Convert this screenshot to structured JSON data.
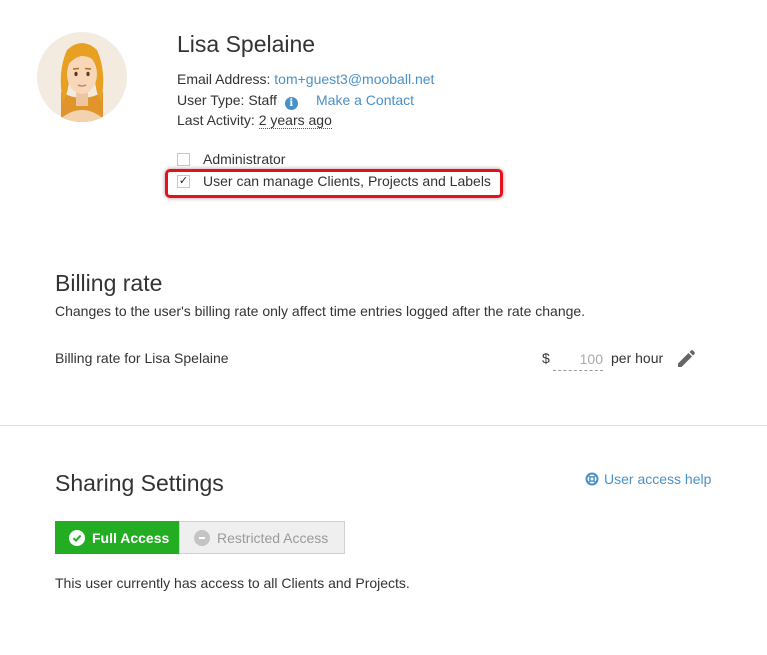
{
  "profile": {
    "name": "Lisa Spelaine",
    "email_label": "Email Address:",
    "email": "tom+guest3@mooball.net",
    "user_type_label": "User Type:",
    "user_type": "Staff",
    "info_icon_glyph": "i",
    "make_contact": "Make a Contact",
    "last_activity_label": "Last Activity:",
    "last_activity": "2 years ago"
  },
  "permissions": {
    "administrator": {
      "label": "Administrator",
      "checked": false
    },
    "manage": {
      "label": "User can manage Clients, Projects and Labels",
      "checked": true,
      "check_glyph": "✓"
    }
  },
  "billing": {
    "title": "Billing rate",
    "description": "Changes to the user's billing rate only affect time entries logged after the rate change.",
    "rate_label": "Billing rate for Lisa Spelaine",
    "currency": "$",
    "rate_value": "100",
    "per_unit": "per hour",
    "edit_icon": "pencil-icon"
  },
  "sharing": {
    "title": "Sharing Settings",
    "help_link": "User access help",
    "help_icon": "lifebuoy-icon",
    "full_access": "Full Access",
    "restricted_access": "Restricted Access",
    "selected": "Full Access",
    "status_text": "This user currently has access to all Clients and Projects."
  },
  "colors": {
    "accent_link": "#4a90c8",
    "full_access_green": "#22ad22",
    "highlight_red": "#e0141e"
  }
}
